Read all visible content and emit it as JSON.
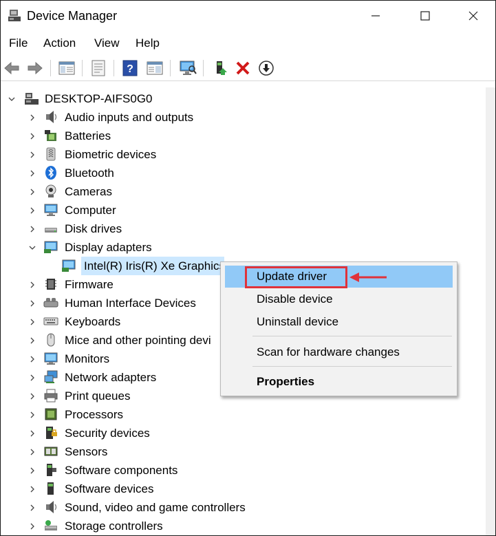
{
  "window": {
    "title": "Device Manager",
    "minimize_glyph": "—",
    "maximize_glyph": "☐",
    "close_glyph": "✕"
  },
  "menu": [
    "File",
    "Action",
    "View",
    "Help"
  ],
  "toolbar_icons": [
    "back-icon",
    "forward-icon",
    "properties-pane-icon",
    "properties-icon",
    "help-icon",
    "view-icon",
    "monitor-icon",
    "update-driver-icon",
    "uninstall-icon",
    "download-icon"
  ],
  "tree": {
    "root": "DESKTOP-AIFS0G0",
    "items": [
      {
        "label": "Audio inputs and outputs",
        "icon": "speaker-icon"
      },
      {
        "label": "Batteries",
        "icon": "battery-icon"
      },
      {
        "label": "Biometric devices",
        "icon": "fingerprint-icon"
      },
      {
        "label": "Bluetooth",
        "icon": "bluetooth-icon"
      },
      {
        "label": "Cameras",
        "icon": "camera-icon"
      },
      {
        "label": "Computer",
        "icon": "computer-icon"
      },
      {
        "label": "Disk drives",
        "icon": "disk-drive-icon"
      },
      {
        "label": "Display adapters",
        "icon": "display-adapter-icon",
        "expanded": true
      },
      {
        "label": "Intel(R) Iris(R) Xe Graphics",
        "icon": "display-adapter-icon",
        "child": true,
        "selected": true
      },
      {
        "label": "Firmware",
        "icon": "firmware-icon"
      },
      {
        "label": "Human Interface Devices",
        "icon": "hid-icon"
      },
      {
        "label": "Keyboards",
        "icon": "keyboard-icon"
      },
      {
        "label": "Mice and other pointing devi",
        "icon": "mouse-icon"
      },
      {
        "label": "Monitors",
        "icon": "monitor-icon"
      },
      {
        "label": "Network adapters",
        "icon": "network-icon"
      },
      {
        "label": "Print queues",
        "icon": "printer-icon"
      },
      {
        "label": "Processors",
        "icon": "processor-icon"
      },
      {
        "label": "Security devices",
        "icon": "security-icon"
      },
      {
        "label": "Sensors",
        "icon": "sensor-icon"
      },
      {
        "label": "Software components",
        "icon": "software-component-icon"
      },
      {
        "label": "Software devices",
        "icon": "software-device-icon"
      },
      {
        "label": "Sound, video and game controllers",
        "icon": "sound-icon"
      },
      {
        "label": "Storage controllers",
        "icon": "storage-icon"
      }
    ]
  },
  "context_menu": {
    "items": [
      "Update driver",
      "Disable device",
      "Uninstall device",
      "Scan for hardware changes",
      "Properties"
    ],
    "highlighted": "Update driver"
  },
  "colors": {
    "selection": "#cce8ff",
    "context_highlight": "#91c9f7",
    "annotation_red": "#e0323a"
  }
}
